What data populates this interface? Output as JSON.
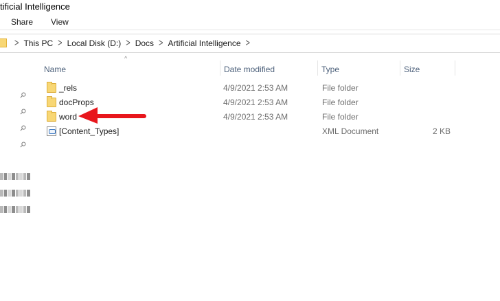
{
  "window": {
    "title": "tificial Intelligence"
  },
  "ribbon": {
    "tabs": [
      "Share",
      "View"
    ]
  },
  "address": {
    "breadcrumb": [
      "This PC",
      "Local Disk (D:)",
      "Docs",
      "Artificial Intelligence"
    ]
  },
  "columns": {
    "name": "Name",
    "date": "Date modified",
    "type": "Type",
    "size": "Size"
  },
  "files": [
    {
      "name": "_rels",
      "date": "4/9/2021 2:53 AM",
      "type": "File folder",
      "size": "",
      "icon": "folder-icon"
    },
    {
      "name": "docProps",
      "date": "4/9/2021 2:53 AM",
      "type": "File folder",
      "size": "",
      "icon": "folder-icon"
    },
    {
      "name": "word",
      "date": "4/9/2021 2:53 AM",
      "type": "File folder",
      "size": "",
      "icon": "folder-icon"
    },
    {
      "name": "[Content_Types]",
      "date": "",
      "type": "XML Document",
      "size": "2 KB",
      "icon": "xml-document-icon"
    }
  ],
  "annotation": {
    "arrow_color": "#e8161c",
    "points_to": "word"
  },
  "colors": {
    "folder": "#f8d775",
    "header_text": "#4c607a"
  }
}
